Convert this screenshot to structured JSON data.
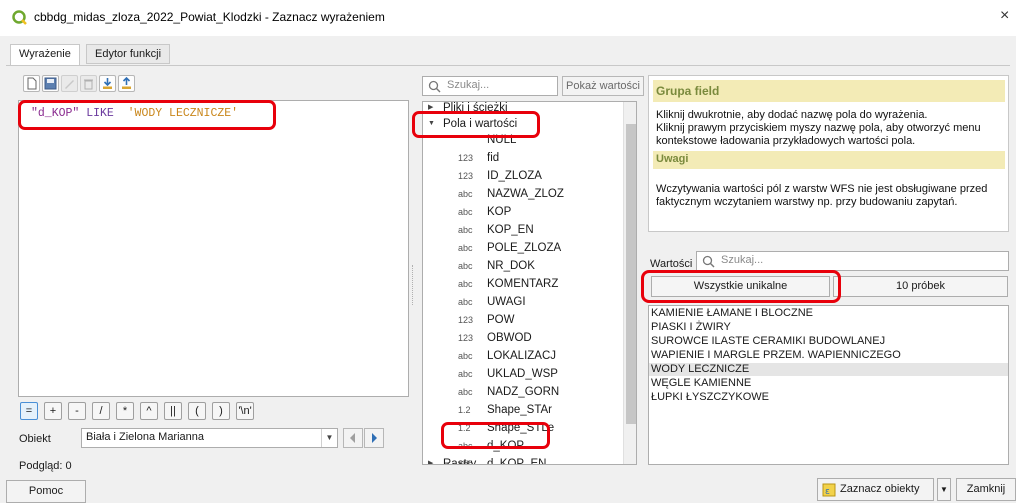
{
  "window": {
    "title": "cbbdg_midas_zloza_2022_Powiat_Klodzki - Zaznacz wyrażeniem",
    "close_glyph": "×"
  },
  "tabs": [
    {
      "label": "Wyrażenie",
      "active": true
    },
    {
      "label": "Edytor funkcji",
      "active": false
    }
  ],
  "editor": {
    "expression": {
      "field": "\"d_KOP\"",
      "operator": "LIKE",
      "value": "'WODY LECZNICZE'"
    },
    "operators": [
      "=",
      "+",
      "-",
      "/",
      "*",
      "^",
      "||",
      "(",
      ")",
      "'\\n'"
    ],
    "feature_label": "Obiekt",
    "feature_value": "Biała i Zielona Marianna",
    "preview_label": "Podgląd: 0"
  },
  "middle": {
    "search_placeholder": "Szukaj...",
    "show_values_label": "Pokaż wartości",
    "tree": {
      "group_files": "Pliki i ścieżki",
      "group_fields": "Pola i wartości",
      "null_item": "NULL",
      "fields": [
        {
          "type": "123",
          "name": "fid"
        },
        {
          "type": "123",
          "name": "ID_ZLOZA"
        },
        {
          "type": "abc",
          "name": "NAZWA_ZLOZ"
        },
        {
          "type": "abc",
          "name": "KOP"
        },
        {
          "type": "abc",
          "name": "KOP_EN"
        },
        {
          "type": "abc",
          "name": "POLE_ZLOZA"
        },
        {
          "type": "abc",
          "name": "NR_DOK"
        },
        {
          "type": "abc",
          "name": "KOMENTARZ"
        },
        {
          "type": "abc",
          "name": "UWAGI"
        },
        {
          "type": "123",
          "name": "POW"
        },
        {
          "type": "123",
          "name": "OBWOD"
        },
        {
          "type": "abc",
          "name": "LOKALIZACJ"
        },
        {
          "type": "abc",
          "name": "UKLAD_WSP"
        },
        {
          "type": "abc",
          "name": "NADZ_GORN"
        },
        {
          "type": "1.2",
          "name": "Shape_STAr"
        },
        {
          "type": "1.2",
          "name": "Shape_STLe"
        },
        {
          "type": "abc",
          "name": "d_KOP"
        },
        {
          "type": "abc",
          "name": "d_KOP_EN"
        }
      ],
      "group_raster": "Rastry"
    }
  },
  "help": {
    "title": "Grupa field",
    "text1": "Kliknij dwukrotnie, aby dodać nazwę pola do wyrażenia.",
    "text2": "Kliknij prawym przyciskiem myszy nazwę pola, aby otworzyć menu kontekstowe ładowania przykładowych wartości pola.",
    "notes_title": "Uwagi",
    "notes_text": "Wczytywania wartości pól z warstw WFS nie jest obsługiwane przed faktycznym wczytaniem warstwy np. przy budowaniu zapytań."
  },
  "values": {
    "label": "Wartości",
    "search_placeholder": "Szukaj...",
    "all_unique_label": "Wszystkie unikalne",
    "samples_label": "10 próbek",
    "items": [
      "KAMIENIE ŁAMANE I BLOCZNE",
      "PIASKI I ŻWIRY",
      "SUROWCE ILASTE CERAMIKI BUDOWLANEJ",
      "WAPIENIE I MARGLE  PRZEM. WAPIENNICZEGO",
      "WODY LECZNICZE",
      "WĘGLE KAMIENNE",
      "ŁUPKI ŁYSZCZYKOWE"
    ],
    "selected_index": 4
  },
  "footer": {
    "help_label": "Pomoc",
    "select_label": "Zaznacz obiekty",
    "close_label": "Zamknij"
  },
  "colors": {
    "highlight": "#e8000b",
    "qgis_green": "#6fa82f",
    "help_header_bg": "#f3ebb6",
    "field_color": "#8a2b8f",
    "keyword_color": "#6b3a9e",
    "string_color": "#c9861a"
  },
  "icons": [
    "qgis-logo-icon",
    "new-file-icon",
    "save-icon",
    "edit-icon",
    "delete-icon",
    "import-icon",
    "export-icon",
    "search-icon",
    "prev-arrow-icon",
    "next-arrow-icon",
    "select-by-expression-icon",
    "chevron-down-icon"
  ]
}
